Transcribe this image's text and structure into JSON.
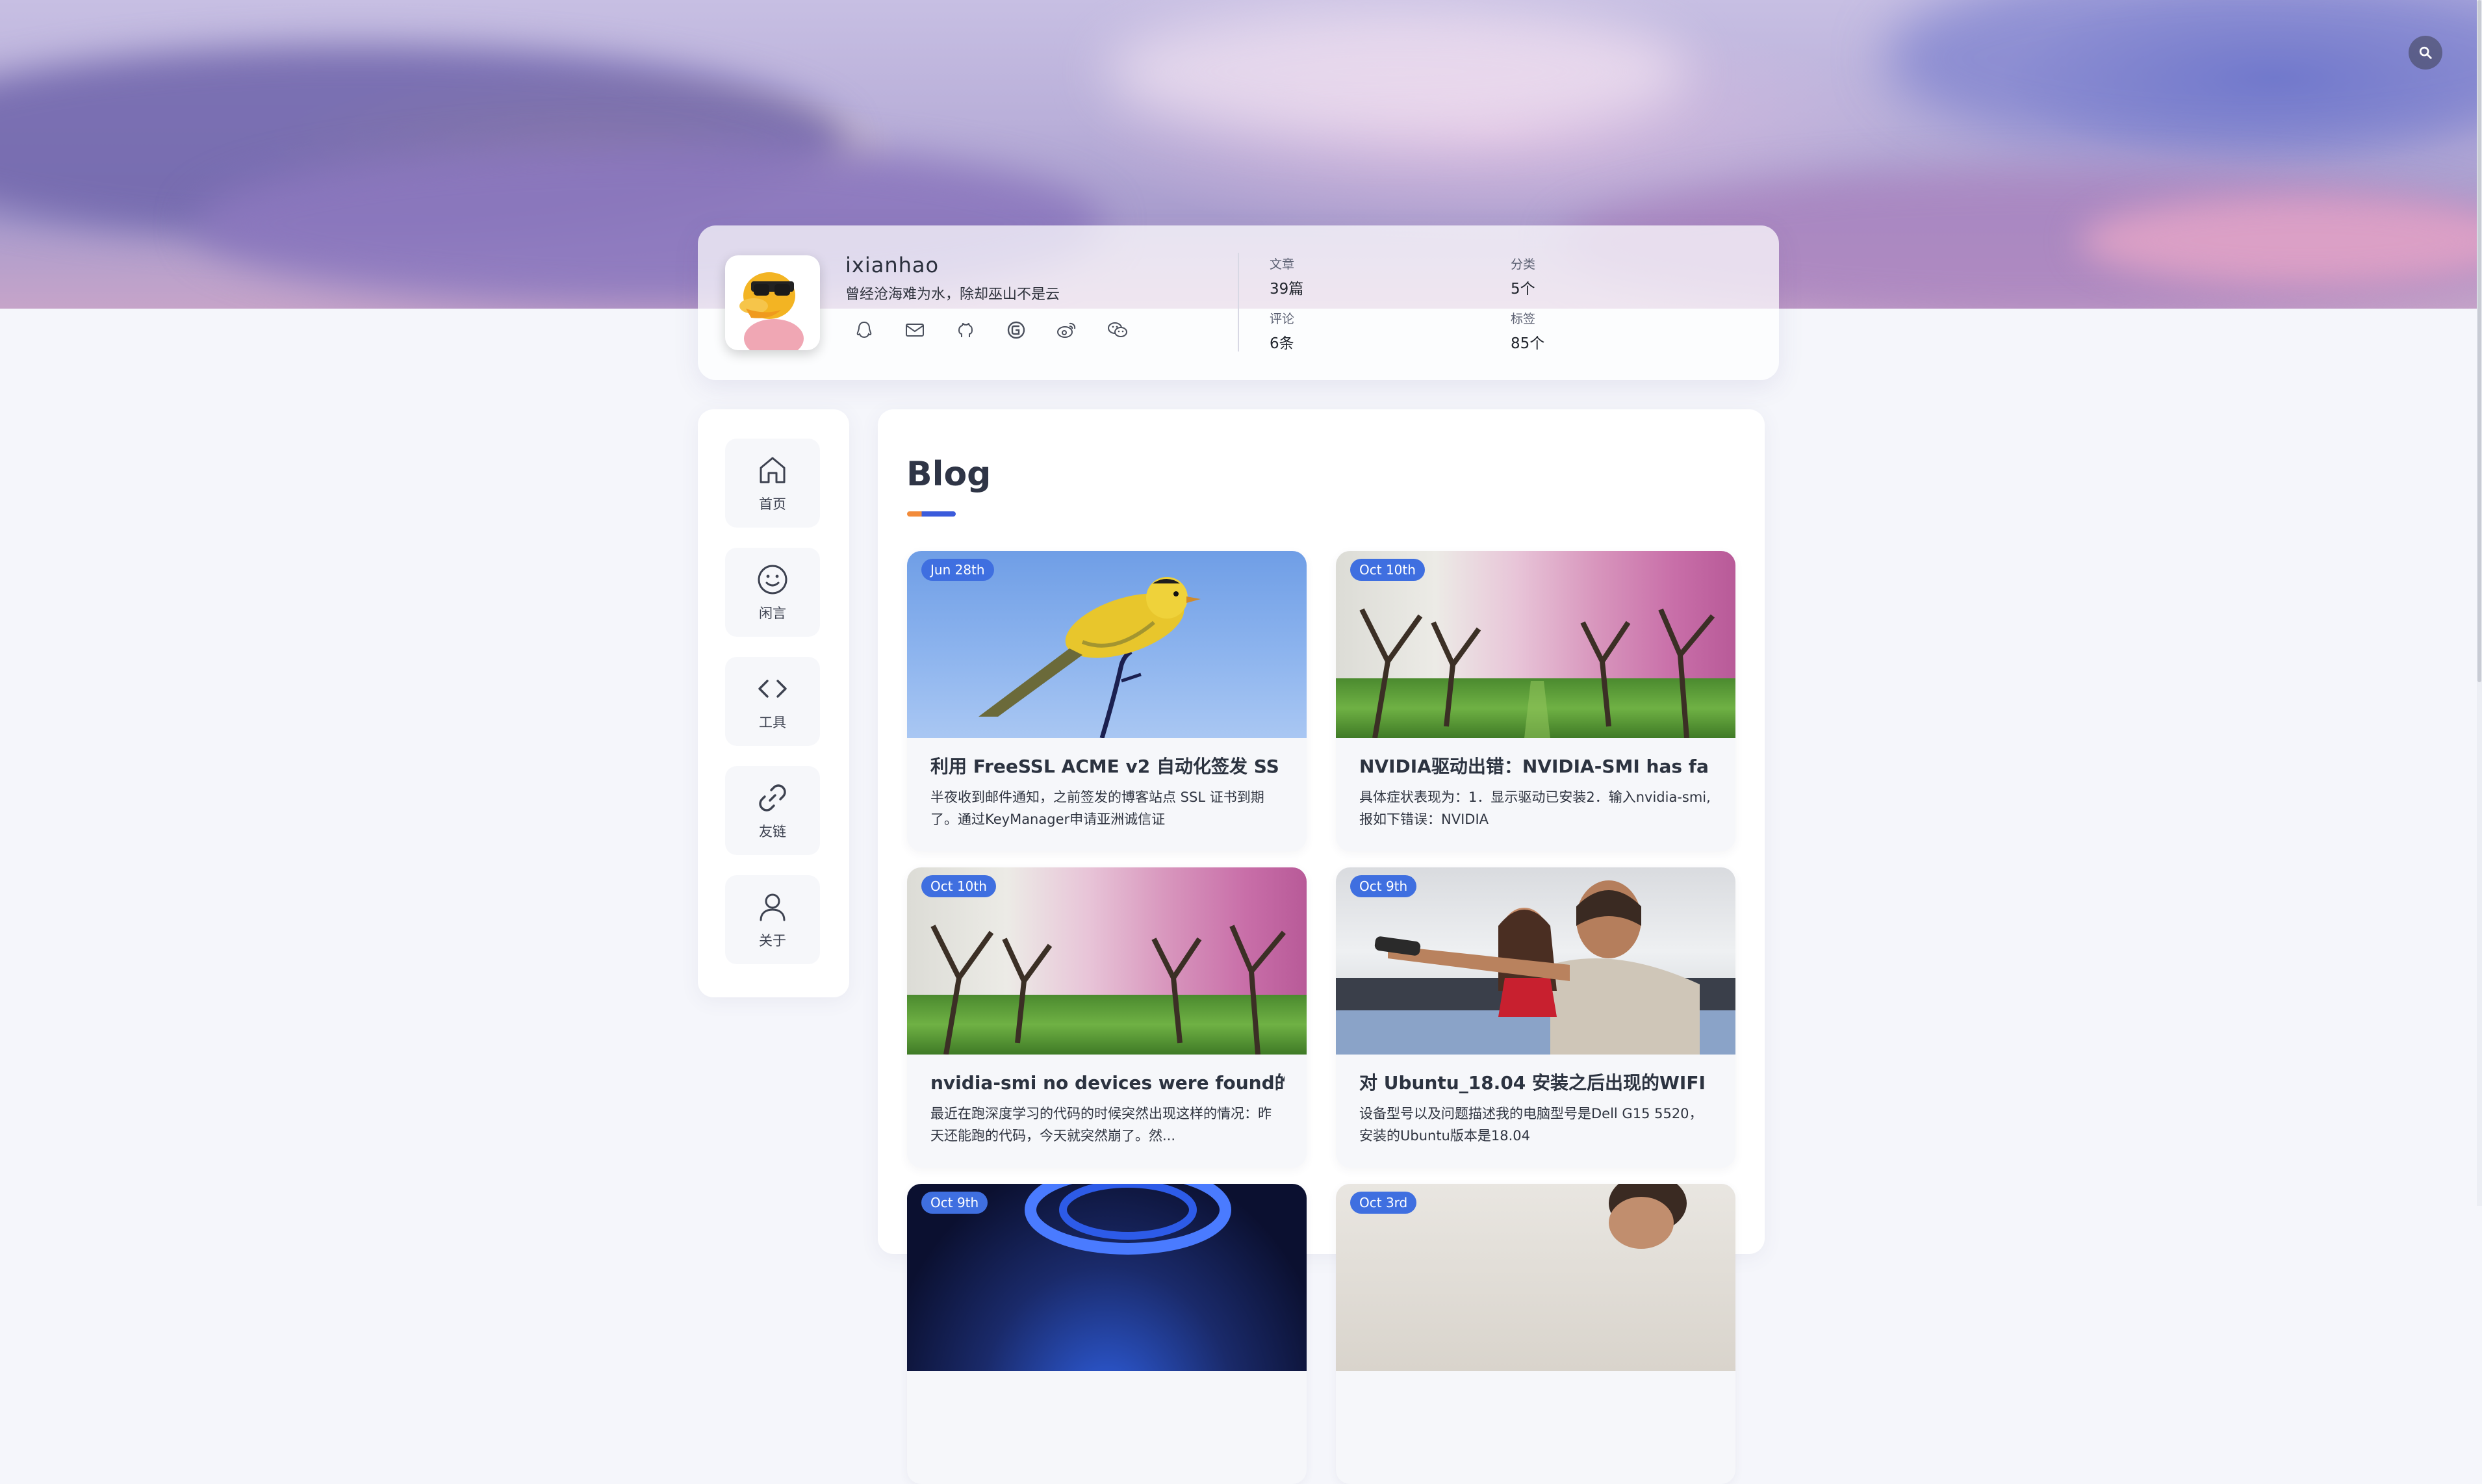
{
  "search": {
    "icon": "search-icon"
  },
  "profile": {
    "name": "ixianhao",
    "motto": "曾经沧海难为水，除却巫山不是云",
    "socials": [
      "qq-icon",
      "mail-icon",
      "github-icon",
      "gitee-icon",
      "weibo-icon",
      "wechat-icon"
    ],
    "stats": {
      "articles": {
        "label": "文章",
        "value": "39篇"
      },
      "categories": {
        "label": "分类",
        "value": "5个"
      },
      "comments": {
        "label": "评论",
        "value": "6条"
      },
      "tags": {
        "label": "标签",
        "value": "85个"
      }
    }
  },
  "nav": [
    {
      "label": "首页",
      "icon": "home-icon"
    },
    {
      "label": "闲言",
      "icon": "smile-icon"
    },
    {
      "label": "工具",
      "icon": "code-icon"
    },
    {
      "label": "友链",
      "icon": "link-icon"
    },
    {
      "label": "关于",
      "icon": "user-icon"
    }
  ],
  "main": {
    "title": "Blog",
    "posts": [
      {
        "date": "Jun 28th",
        "title": "利用 FreeSSL ACME v2 自动化签发 SS",
        "excerpt": "半夜收到邮件通知，之前签发的博客站点 SSL 证书到期了。通过KeyManager申请亚洲诚信证"
      },
      {
        "date": "Oct 10th",
        "title": "NVIDIA驱动出错：NVIDIA-SMI has fa",
        "excerpt": "具体症状表现为：1．显示驱动已安装2．输入nvidia-smi,报如下错误：NVIDIA"
      },
      {
        "date": "Oct 10th",
        "title": "nvidia-smi no devices were found的",
        "excerpt": "最近在跑深度学习的代码的时候突然出现这样的情况：昨天还能跑的代码，今天就突然崩了。然..."
      },
      {
        "date": "Oct 9th",
        "title": "对 Ubuntu_18.04 安装之后出现的WIFI",
        "excerpt": "设备型号以及问题描述我的电脑型号是Dell G15 5520，安装的Ubuntu版本是18.04"
      },
      {
        "date": "Oct 9th",
        "title": "",
        "excerpt": ""
      },
      {
        "date": "Oct 3rd",
        "title": "",
        "excerpt": ""
      }
    ]
  }
}
